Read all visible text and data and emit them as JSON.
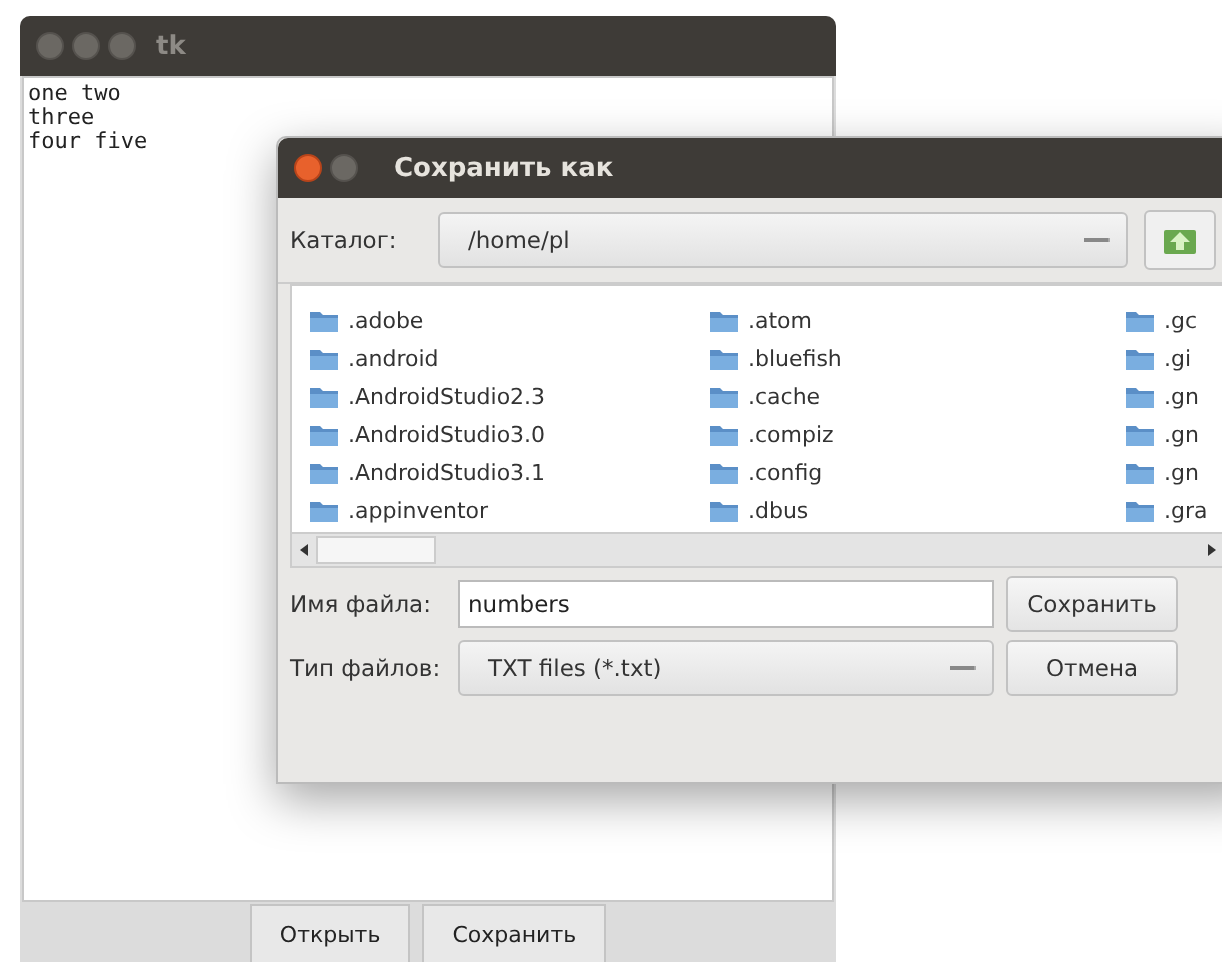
{
  "main_window": {
    "title": "tk",
    "text_lines": [
      "one two",
      "three",
      "four five"
    ],
    "buttons": [
      "Открыть",
      "Сохранить"
    ]
  },
  "dialog": {
    "title": "Сохранить как",
    "directory_label": "Каталог:",
    "directory": "/home/pl",
    "file_columns": [
      [
        ".adobe",
        ".android",
        ".AndroidStudio2.3",
        ".AndroidStudio3.0",
        ".AndroidStudio3.1",
        ".appinventor"
      ],
      [
        ".atom",
        ".bluefish",
        ".cache",
        ".compiz",
        ".config",
        ".dbus"
      ],
      [
        ".gc",
        ".gi",
        ".gn",
        ".gn",
        ".gn",
        ".gra"
      ]
    ],
    "filename_label": "Имя файла:",
    "filename": "numbers",
    "filetype_label": "Тип файлов:",
    "filetype": "TXT files (*.txt)",
    "save_button": "Сохранить",
    "cancel_button": "Отмена"
  }
}
